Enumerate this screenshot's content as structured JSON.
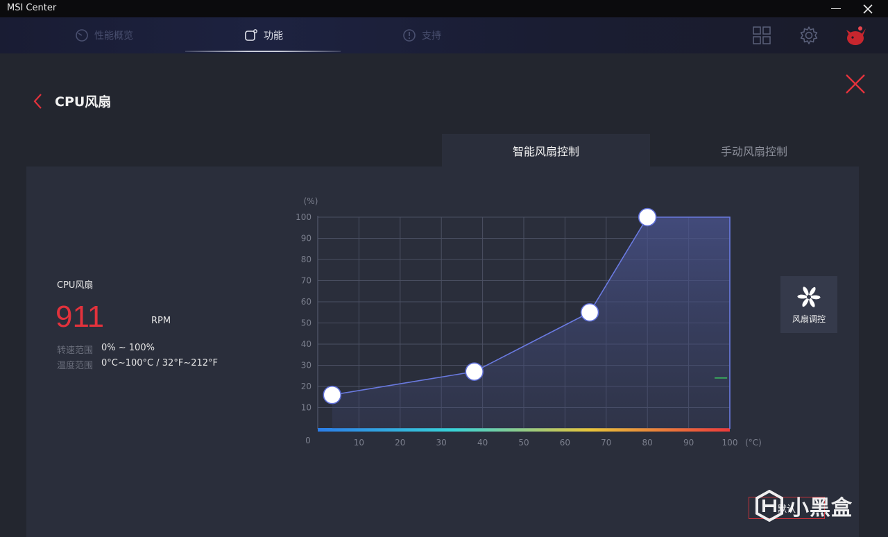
{
  "window": {
    "title": "MSI Center"
  },
  "nav": {
    "tabs": [
      {
        "label": "性能概览",
        "active": false
      },
      {
        "label": "功能",
        "active": true
      },
      {
        "label": "支持",
        "active": false
      }
    ]
  },
  "page": {
    "title": "CPU风扇"
  },
  "mode_tabs": {
    "smart": "智能风扇控制",
    "manual": "手动风扇控制"
  },
  "fan": {
    "name": "CPU风扇",
    "rpm": "911",
    "rpm_unit": "RPM",
    "speed_range_label": "转速范围",
    "speed_range": "0% ~ 100%",
    "temp_range_label": "温度范围",
    "temp_range": "0°C~100°C / 32°F~212°F"
  },
  "chart_data": {
    "type": "line",
    "ylabel": "(%)",
    "xlabel": "(°C)",
    "x_ticks": [
      "0",
      "10",
      "20",
      "30",
      "40",
      "50",
      "60",
      "70",
      "80",
      "90",
      "100"
    ],
    "y_ticks": [
      "100",
      "90",
      "80",
      "70",
      "60",
      "50",
      "40",
      "30",
      "20",
      "10"
    ],
    "xlim": [
      0,
      100
    ],
    "ylim": [
      0,
      100
    ],
    "grid": true,
    "points": [
      {
        "x": 3.5,
        "y": 16
      },
      {
        "x": 38,
        "y": 27
      },
      {
        "x": 66,
        "y": 55
      },
      {
        "x": 80,
        "y": 100
      }
    ],
    "fill_to_x": 100,
    "current_temp": 98,
    "current_fan_percent": 24,
    "colors": {
      "line": "#6a7ae0",
      "fill": "#3e4670",
      "point": "#ffffff",
      "marker": "#3bbd5e",
      "gradient": [
        "#2b7de8",
        "#38d4d8",
        "#e8c53a",
        "#ee3a3a"
      ]
    }
  },
  "fan_control": {
    "label": "风扇调控"
  },
  "default_button": {
    "label": "默认"
  },
  "watermark": {
    "text": "小黑盒"
  },
  "colors": {
    "accent": "#e2323c",
    "panel": "#2a2e3b",
    "background": "#23262f"
  }
}
